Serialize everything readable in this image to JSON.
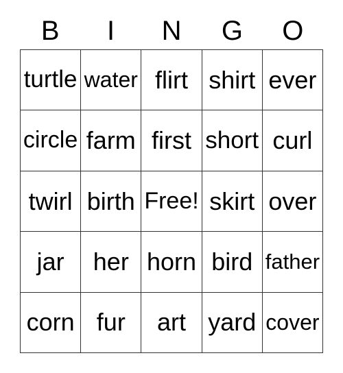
{
  "card": {
    "title": "BINGO",
    "header_letters": [
      "B",
      "I",
      "N",
      "G",
      "O"
    ],
    "free_space_label": "Free!",
    "grid_line_color": "#333333",
    "text_color": "#000000",
    "background_color": "#ffffff",
    "rows": 5,
    "columns": 5,
    "cells": [
      [
        {
          "text": "turtle"
        },
        {
          "text": "water"
        },
        {
          "text": "flirt"
        },
        {
          "text": "shirt"
        },
        {
          "text": "ever"
        }
      ],
      [
        {
          "text": "circle"
        },
        {
          "text": "farm"
        },
        {
          "text": "first"
        },
        {
          "text": "short"
        },
        {
          "text": "curl"
        }
      ],
      [
        {
          "text": "twirl"
        },
        {
          "text": "birth"
        },
        {
          "text": "Free!"
        },
        {
          "text": "skirt"
        },
        {
          "text": "over"
        }
      ],
      [
        {
          "text": "jar"
        },
        {
          "text": "her"
        },
        {
          "text": "horn"
        },
        {
          "text": "bird"
        },
        {
          "text": "father"
        }
      ],
      [
        {
          "text": "corn"
        },
        {
          "text": "fur"
        },
        {
          "text": "art"
        },
        {
          "text": "yard"
        },
        {
          "text": "cover"
        }
      ]
    ]
  }
}
